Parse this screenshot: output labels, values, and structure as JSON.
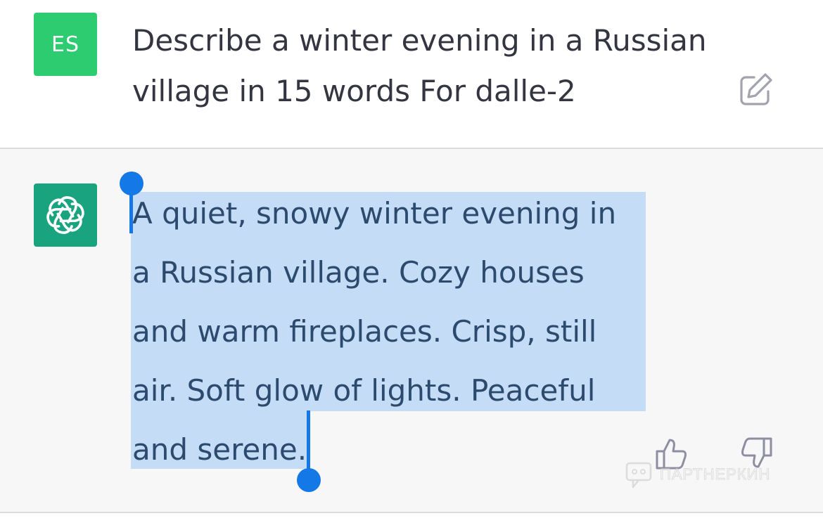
{
  "user_message": {
    "avatar_initials": "ES",
    "text": "Describe a winter evening in a Russian village in 15 words For dalle-2",
    "edit_icon": "edit-icon"
  },
  "assistant_message": {
    "avatar_icon": "openai-logo-icon",
    "lines": [
      "A quiet, snowy winter evening in",
      "a Russian village. Cozy houses",
      "and warm fireplaces. Crisp, still",
      "air. Soft glow of lights. Peaceful",
      "and serene."
    ],
    "thumbs_up_icon": "thumbs-up-icon",
    "thumbs_down_icon": "thumbs-down-icon"
  },
  "watermark": {
    "text": "ПАРТНЕРКИН"
  },
  "colors": {
    "user_avatar": "#2ecc71",
    "assistant_avatar": "#19a37f",
    "selection": "#c5dcf6",
    "selection_handle": "#1478e6"
  }
}
